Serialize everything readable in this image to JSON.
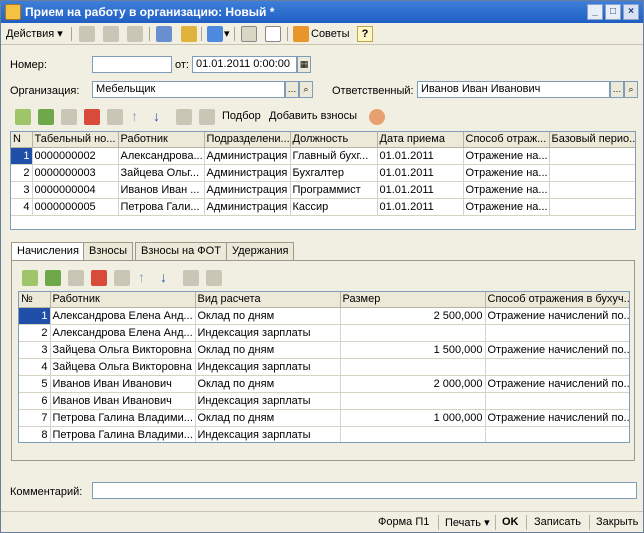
{
  "window": {
    "title": "Прием на работу в организацию: Новый *",
    "minimize": "_",
    "maximize": "□",
    "close": "×"
  },
  "toolbar": {
    "actions_label": "Действия",
    "tips_label": "Советы",
    "help_label": "?"
  },
  "form": {
    "number_label": "Номер:",
    "number_value": "",
    "date_label": "от:",
    "date_value": "01.01.2011  0:00:00",
    "org_label": "Организация:",
    "org_value": "Мебельщик",
    "resp_label": "Ответственный:",
    "resp_value": "Иванов Иван Иванович",
    "comment_label": "Комментарий:",
    "comment_value": ""
  },
  "emp_toolbar": {
    "select_label": "Подбор",
    "add_contrib_label": "Добавить взносы"
  },
  "employees": {
    "columns": [
      "N",
      "Табельный но...",
      "Работник",
      "Подразделени...",
      "Должность",
      "Дата приема",
      "Способ отраж...",
      "Базовый перио..."
    ],
    "rows": [
      [
        "1",
        "0000000002",
        "Александрова...",
        "Администрация",
        "Главный бухг...",
        "01.01.2011",
        "Отражение на...",
        ""
      ],
      [
        "2",
        "0000000003",
        "Зайцева Ольг...",
        "Администрация",
        "Бухгалтер",
        "01.01.2011",
        "Отражение на...",
        ""
      ],
      [
        "3",
        "0000000004",
        "Иванов Иван ...",
        "Администрация",
        "Программист",
        "01.01.2011",
        "Отражение на...",
        ""
      ],
      [
        "4",
        "0000000005",
        "Петрова Гали...",
        "Администрация",
        "Кассир",
        "01.01.2011",
        "Отражение на...",
        ""
      ]
    ]
  },
  "tabs": [
    "Начисления",
    "Взносы",
    "Взносы на ФОТ",
    "Удержания"
  ],
  "accruals": {
    "columns": [
      "№",
      "Работник",
      "Вид расчета",
      "Размер",
      "Способ отражения в бухуч..."
    ],
    "rows": [
      [
        "1",
        "Александрова Елена Анд...",
        "Оклад по дням",
        "2 500,000",
        "Отражение начислений по..."
      ],
      [
        "2",
        "Александрова Елена Анд...",
        "Индексация зарплаты",
        "",
        ""
      ],
      [
        "3",
        "Зайцева Ольга Викторовна",
        "Оклад по дням",
        "1 500,000",
        "Отражение начислений по..."
      ],
      [
        "4",
        "Зайцева Ольга Викторовна",
        "Индексация зарплаты",
        "",
        ""
      ],
      [
        "5",
        "Иванов Иван Иванович",
        "Оклад по дням",
        "2 000,000",
        "Отражение начислений по..."
      ],
      [
        "6",
        "Иванов Иван Иванович",
        "Индексация зарплаты",
        "",
        ""
      ],
      [
        "7",
        "Петрова Галина Владими...",
        "Оклад по дням",
        "1 000,000",
        "Отражение начислений по..."
      ],
      [
        "8",
        "Петрова Галина Владими...",
        "Индексация зарплаты",
        "",
        ""
      ]
    ]
  },
  "status": {
    "form_p1": "Форма П1",
    "print": "Печать",
    "ok": "OK",
    "save": "Записать",
    "close": "Закрыть"
  }
}
